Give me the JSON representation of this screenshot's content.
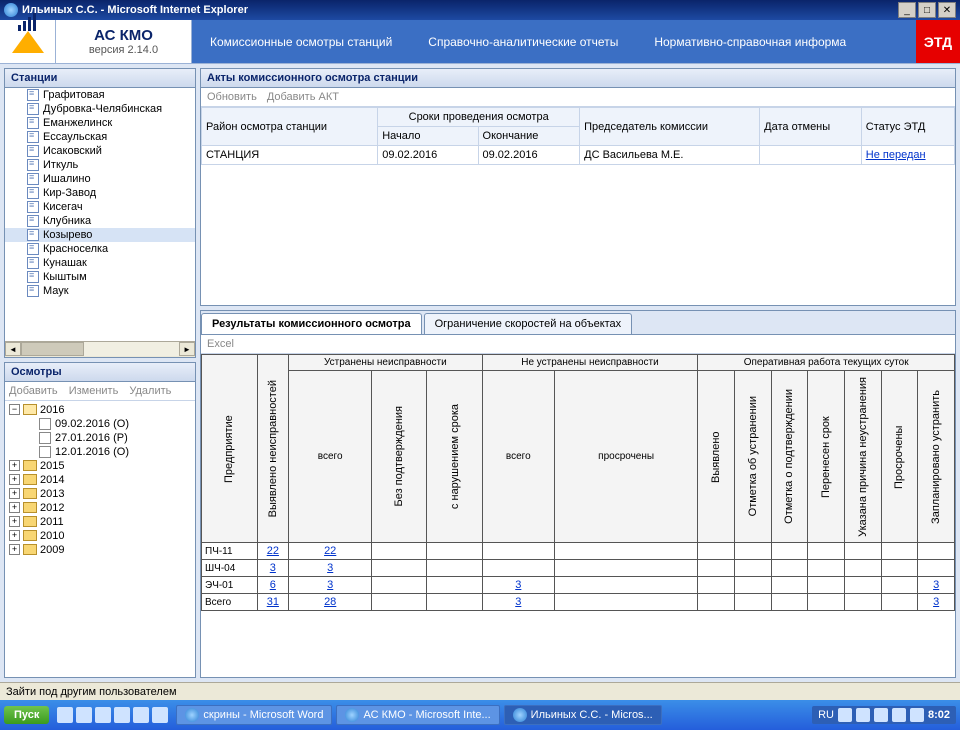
{
  "window": {
    "title": "Ильиных С.С. - Microsoft Internet Explorer"
  },
  "brand": {
    "title": "АС КМО",
    "version": "версия 2.14.0"
  },
  "menu": {
    "m1": "Комиссионные осмотры станций",
    "m2": "Справочно-аналитические отчеты",
    "m3": "Нормативно-справочная информа",
    "etd": "ЭТД"
  },
  "stations_panel": {
    "title": "Станции"
  },
  "stations": [
    "Графитовая",
    "Дубровка-Челябинская",
    "Еманжелинск",
    "Ессаульская",
    "Исаковский",
    "Иткуль",
    "Ишалино",
    "Кир-Завод",
    "Кисегач",
    "Клубника",
    "Козырево",
    "Красноселка",
    "Кунашак",
    "Кыштым",
    "Маук"
  ],
  "selected_station_index": 10,
  "osm_panel": {
    "title": "Осмотры",
    "add": "Добавить",
    "edit": "Изменить",
    "del": "Удалить"
  },
  "osm_tree": {
    "y2016": "2016",
    "items2016": [
      "09.02.2016 (О)",
      "27.01.2016 (Р)",
      "12.01.2016 (О)"
    ],
    "years": [
      "2015",
      "2014",
      "2013",
      "2012",
      "2011",
      "2010",
      "2009"
    ]
  },
  "acts": {
    "title": "Акты комиссионного осмотра станции",
    "refresh": "Обновить",
    "add": "Добавить АКТ",
    "h_region": "Район осмотра станции",
    "h_period": "Сроки проведения осмотра",
    "h_start": "Начало",
    "h_end": "Окончание",
    "h_chair": "Председатель комиссии",
    "h_cancel": "Дата отмены",
    "h_status": "Статус ЭТД",
    "row": {
      "region": "СТАНЦИЯ",
      "start": "09.02.2016",
      "end": "09.02.2016",
      "chair": "ДС Васильева М.Е.",
      "cancel": "",
      "status": "Не передан"
    }
  },
  "tabs": {
    "t1": "Результаты комиссионного осмотра",
    "t2": "Ограничение скоростей на объектах"
  },
  "excel": "Excel",
  "res_headers": {
    "pred": "Предприятие",
    "found": "Выявлено неисправностей",
    "fixed_group": "Устранены неисправности",
    "fixed_all": "всего",
    "fixed_noconf": "Без подтверждения",
    "fixed_late": "с нарушением срока",
    "unfixed_group": "Не устранены неисправности",
    "unfixed_all": "всего",
    "unfixed_over": "просрочены",
    "oper_group": "Оперативная работа текущих суток",
    "op1": "Выявлено",
    "op2": "Отметка об устранении",
    "op3": "Отметка о подтверждении",
    "op4": "Перенесен срок",
    "op5": "Указана причина неустранения",
    "op6": "Просрочены",
    "op7": "Запланировано устранить"
  },
  "res_rows": [
    {
      "pred": "ПЧ-11",
      "found": "22",
      "fixed_all": "22",
      "fixed_noconf": "",
      "fixed_late": "",
      "unfixed_all": "",
      "unfixed_over": "",
      "op1": "",
      "op2": "",
      "op3": "",
      "op4": "",
      "op5": "",
      "op6": "",
      "op7": ""
    },
    {
      "pred": "ШЧ-04",
      "found": "3",
      "fixed_all": "3",
      "fixed_noconf": "",
      "fixed_late": "",
      "unfixed_all": "",
      "unfixed_over": "",
      "op1": "",
      "op2": "",
      "op3": "",
      "op4": "",
      "op5": "",
      "op6": "",
      "op7": ""
    },
    {
      "pred": "ЭЧ-01",
      "found": "6",
      "fixed_all": "3",
      "fixed_noconf": "",
      "fixed_late": "",
      "unfixed_all": "3",
      "unfixed_over": "",
      "op1": "",
      "op2": "",
      "op3": "",
      "op4": "",
      "op5": "",
      "op6": "",
      "op7": "3"
    },
    {
      "pred": "Всего",
      "found": "31",
      "fixed_all": "28",
      "fixed_noconf": "",
      "fixed_late": "",
      "unfixed_all": "3",
      "unfixed_over": "",
      "op1": "",
      "op2": "",
      "op3": "",
      "op4": "",
      "op5": "",
      "op6": "",
      "op7": "3"
    }
  ],
  "status": "Зайти под другим пользователем",
  "taskbar": {
    "start": "Пуск",
    "btn1": "скрины - Microsoft Word",
    "btn2": "АС КМО - Microsoft Inte...",
    "btn3": "Ильиных С.С. - Micros...",
    "lang": "RU",
    "clock": "8:02"
  }
}
